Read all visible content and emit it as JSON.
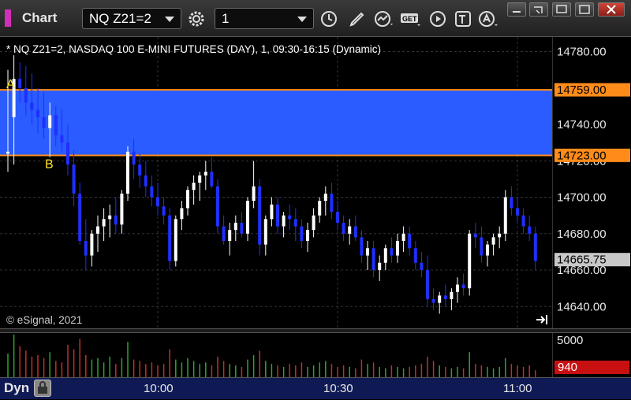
{
  "app": {
    "title": "Chart",
    "accent": "#d02fb8"
  },
  "toolbar": {
    "symbol": "NQ Z21=2",
    "interval": "1",
    "icons": [
      "settings-gear-icon",
      "clock-icon",
      "pencil-draw-icon",
      "study-chart-icon",
      "get-data-icon",
      "play-replay-icon",
      "text-tool-icon",
      "alert-icon"
    ],
    "get_label": "GET"
  },
  "header": {
    "description": "* NQ Z21=2, NASDAQ 100 E-MINI FUTURES (DAY), 1, 09:30-16:15 (Dynamic)"
  },
  "copyright": "© eSignal, 2021",
  "annotations": {
    "a": "A",
    "b": "B"
  },
  "bottom": {
    "mode_label": "Dyn"
  },
  "chart_data": {
    "type": "candlestick",
    "price_ticks": [
      "14780.00",
      "14740.00",
      "14720.00",
      "14700.00",
      "14680.00",
      "14660.00",
      "14640.00"
    ],
    "price_tick_values": [
      14780,
      14740,
      14720,
      14700,
      14680,
      14660,
      14640
    ],
    "time_labels": [
      "10:00",
      "10:30",
      "11:00"
    ],
    "time_label_bars": [
      25,
      55,
      85
    ],
    "ylim": [
      14628,
      14788
    ],
    "zone": {
      "top": 14759.0,
      "bottom": 14723.0,
      "top_label": "14759.00",
      "bottom_label": "14723.00",
      "fill": "#2a5cff",
      "line": "#ff8c1a"
    },
    "last_price": {
      "value": 14665.75,
      "label": "14665.75"
    },
    "volume": {
      "tick_label": "5000",
      "last_label": "940",
      "max": 6000,
      "up_color": "#2ea52e",
      "down_color": "#c0302a"
    },
    "candles": [
      [
        14724,
        14770,
        14714,
        14725
      ],
      [
        14744,
        14778,
        14718,
        14765
      ],
      [
        14765,
        14774,
        14752,
        14760
      ],
      [
        14760,
        14772,
        14745,
        14752
      ],
      [
        14752,
        14768,
        14740,
        14748
      ],
      [
        14748,
        14760,
        14735,
        14744
      ],
      [
        14744,
        14758,
        14732,
        14738
      ],
      [
        14738,
        14752,
        14722,
        14745
      ],
      [
        14745,
        14750,
        14728,
        14734
      ],
      [
        14734,
        14748,
        14725,
        14730
      ],
      [
        14730,
        14740,
        14712,
        14718
      ],
      [
        14718,
        14726,
        14695,
        14702
      ],
      [
        14702,
        14708,
        14674,
        14676
      ],
      [
        14676,
        14688,
        14660,
        14668
      ],
      [
        14668,
        14682,
        14662,
        14680
      ],
      [
        14680,
        14690,
        14670,
        14684
      ],
      [
        14684,
        14694,
        14676,
        14688
      ],
      [
        14688,
        14696,
        14678,
        14690
      ],
      [
        14690,
        14700,
        14680,
        14685
      ],
      [
        14685,
        14704,
        14680,
        14702
      ],
      [
        14702,
        14728,
        14698,
        14725
      ],
      [
        14725,
        14732,
        14710,
        14718
      ],
      [
        14718,
        14724,
        14705,
        14712
      ],
      [
        14712,
        14720,
        14700,
        14706
      ],
      [
        14706,
        14712,
        14695,
        14700
      ],
      [
        14700,
        14708,
        14690,
        14695
      ],
      [
        14695,
        14700,
        14685,
        14690
      ],
      [
        14690,
        14694,
        14660,
        14665
      ],
      [
        14665,
        14690,
        14662,
        14688
      ],
      [
        14688,
        14698,
        14682,
        14694
      ],
      [
        14694,
        14706,
        14690,
        14704
      ],
      [
        14704,
        14712,
        14696,
        14708
      ],
      [
        14708,
        14714,
        14698,
        14712
      ],
      [
        14712,
        14720,
        14704,
        14714
      ],
      [
        14714,
        14722,
        14705,
        14706
      ],
      [
        14706,
        14710,
        14680,
        14684
      ],
      [
        14684,
        14690,
        14674,
        14676
      ],
      [
        14676,
        14686,
        14668,
        14682
      ],
      [
        14682,
        14690,
        14676,
        14686
      ],
      [
        14686,
        14692,
        14678,
        14680
      ],
      [
        14680,
        14700,
        14676,
        14698
      ],
      [
        14698,
        14720,
        14694,
        14706
      ],
      [
        14706,
        14710,
        14668,
        14674
      ],
      [
        14674,
        14690,
        14668,
        14688
      ],
      [
        14688,
        14700,
        14684,
        14696
      ],
      [
        14696,
        14700,
        14680,
        14684
      ],
      [
        14684,
        14692,
        14678,
        14690
      ],
      [
        14690,
        14696,
        14682,
        14688
      ],
      [
        14688,
        14694,
        14676,
        14684
      ],
      [
        14684,
        14688,
        14672,
        14676
      ],
      [
        14676,
        14686,
        14670,
        14682
      ],
      [
        14682,
        14694,
        14678,
        14690
      ],
      [
        14690,
        14700,
        14686,
        14698
      ],
      [
        14698,
        14706,
        14690,
        14702
      ],
      [
        14702,
        14708,
        14688,
        14692
      ],
      [
        14692,
        14698,
        14682,
        14686
      ],
      [
        14686,
        14690,
        14676,
        14680
      ],
      [
        14680,
        14688,
        14674,
        14684
      ],
      [
        14684,
        14690,
        14676,
        14678
      ],
      [
        14678,
        14682,
        14664,
        14668
      ],
      [
        14668,
        14676,
        14660,
        14672
      ],
      [
        14672,
        14676,
        14656,
        14660
      ],
      [
        14660,
        14668,
        14654,
        14664
      ],
      [
        14664,
        14674,
        14660,
        14672
      ],
      [
        14672,
        14678,
        14664,
        14668
      ],
      [
        14668,
        14680,
        14664,
        14676
      ],
      [
        14676,
        14684,
        14670,
        14680
      ],
      [
        14680,
        14684,
        14668,
        14672
      ],
      [
        14672,
        14676,
        14660,
        14664
      ],
      [
        14664,
        14670,
        14656,
        14660
      ],
      [
        14660,
        14668,
        14640,
        14644
      ],
      [
        14644,
        14650,
        14638,
        14642
      ],
      [
        14642,
        14648,
        14636,
        14646
      ],
      [
        14646,
        14652,
        14640,
        14644
      ],
      [
        14644,
        14650,
        14638,
        14648
      ],
      [
        14648,
        14656,
        14642,
        14652
      ],
      [
        14652,
        14658,
        14646,
        14650
      ],
      [
        14650,
        14682,
        14646,
        14680
      ],
      [
        14680,
        14686,
        14672,
        14678
      ],
      [
        14678,
        14684,
        14664,
        14668
      ],
      [
        14668,
        14676,
        14662,
        14674
      ],
      [
        14674,
        14680,
        14668,
        14678
      ],
      [
        14678,
        14684,
        14672,
        14680
      ],
      [
        14680,
        14704,
        14676,
        14700
      ],
      [
        14700,
        14706,
        14690,
        14694
      ],
      [
        14694,
        14700,
        14686,
        14690
      ],
      [
        14690,
        14694,
        14680,
        14684
      ],
      [
        14684,
        14690,
        14676,
        14680
      ],
      [
        14680,
        14684,
        14660,
        14665
      ]
    ],
    "volumes": [
      3200,
      5800,
      4200,
      3600,
      2800,
      3000,
      2600,
      3400,
      2200,
      2000,
      4400,
      3800,
      5200,
      3000,
      2400,
      2600,
      2000,
      2800,
      1800,
      2600,
      4800,
      2400,
      2200,
      1800,
      2000,
      1600,
      1800,
      3800,
      2400,
      2000,
      2600,
      2200,
      1800,
      2000,
      1600,
      2800,
      2200,
      1800,
      1600,
      1400,
      2400,
      3000,
      3600,
      2200,
      1800,
      1600,
      1400,
      1800,
      1600,
      2000,
      1400,
      1600,
      2000,
      2200,
      1800,
      1400,
      1600,
      1400,
      1200,
      2400,
      1800,
      2000,
      1400,
      1200,
      1600,
      1400,
      1200,
      1400,
      1600,
      1800,
      2800,
      2200,
      1600,
      1400,
      1200,
      1400,
      1200,
      3400,
      1800,
      1600,
      1400,
      1200,
      1400,
      2600,
      1800,
      1600,
      1400,
      1600,
      940
    ]
  }
}
